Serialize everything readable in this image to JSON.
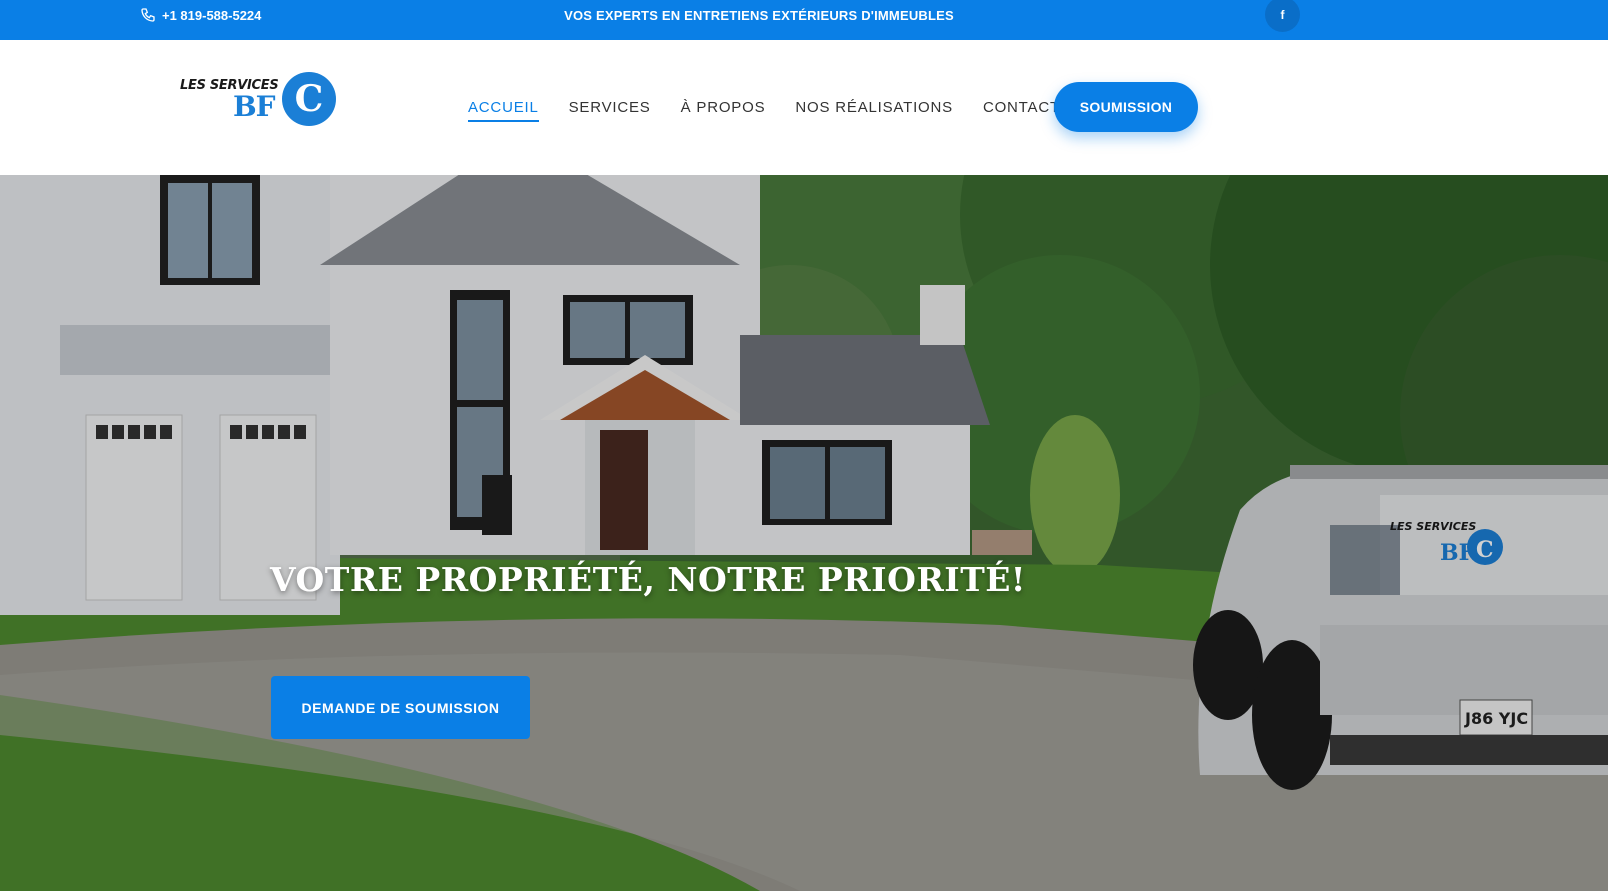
{
  "topbar": {
    "phone": "+1 819-588-5224",
    "tagline": "VOS EXPERTS EN ENTRETIENS EXTÉRIEURS D'IMMEUBLES",
    "facebook": "f"
  },
  "logo": {
    "line1": "LES SERVICES",
    "line2": "BF",
    "badge": "C"
  },
  "nav": {
    "items": [
      {
        "label": "ACCUEIL",
        "active": true
      },
      {
        "label": "SERVICES",
        "active": false
      },
      {
        "label": "À PROPOS",
        "active": false
      },
      {
        "label": "NOS RÉALISATIONS",
        "active": false
      },
      {
        "label": "CONTACT",
        "active": false
      }
    ],
    "cta": "SOUMISSION"
  },
  "hero": {
    "title": "VOTRE PROPRIÉTÉ, NOTRE PRIORITÉ!",
    "button": "DEMANDE DE SOUMISSION",
    "truck_logo_line1": "LES SERVICES",
    "truck_logo_line2": "BF",
    "truck_logo_badge": "C",
    "plate": "J86 YJC"
  },
  "colors": {
    "primary": "#0a7fe6",
    "topbar": "#0a7fe6",
    "nav_text": "#333333"
  }
}
